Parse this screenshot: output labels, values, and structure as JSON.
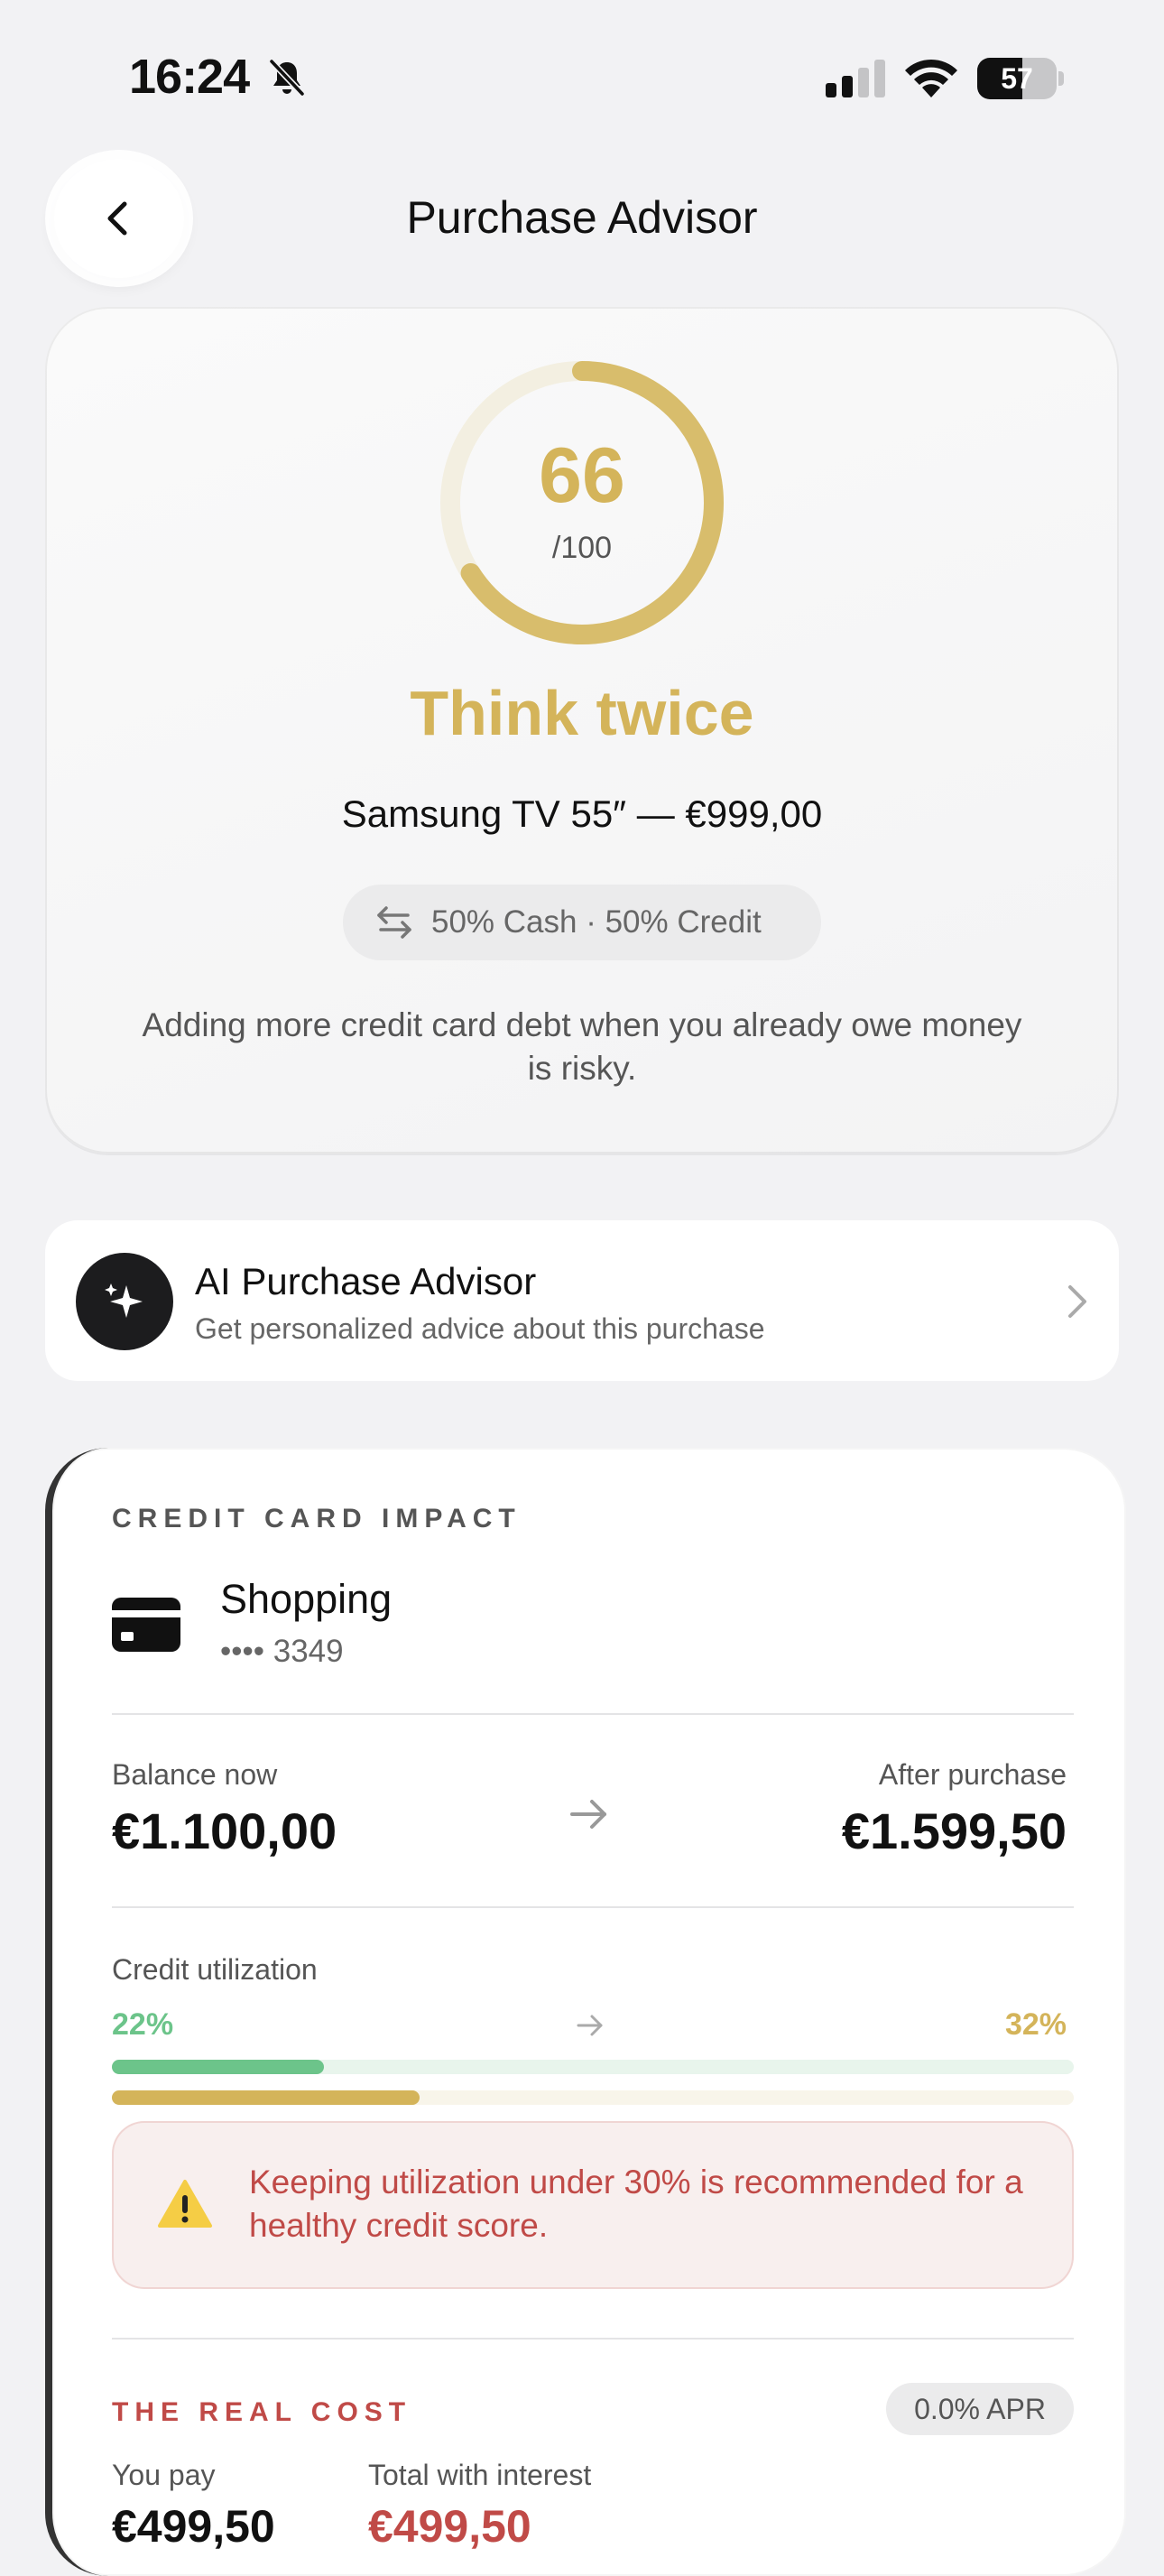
{
  "status_bar": {
    "time": "16:24",
    "battery_level": "57",
    "battery_fraction": 0.57,
    "signal_bars_active": 2,
    "signal_bars_total": 4
  },
  "nav": {
    "back_icon": "chevron-left-icon",
    "title": "Purchase Advisor"
  },
  "score_card": {
    "score": "66",
    "score_max": "/100",
    "score_fraction": 0.66,
    "verdict": "Think twice",
    "product": "Samsung TV 55″ — €999,00",
    "payment_split": "50% Cash · 50% Credit",
    "payment_icon": "swap-arrows-icon",
    "advice": "Adding more credit card debt when you already owe money is risky."
  },
  "ai_advisor": {
    "icon": "sparkles-icon",
    "title": "AI Purchase Advisor",
    "subtitle": "Get personalized advice about this purchase"
  },
  "credit_impact": {
    "section_title": "CREDIT CARD IMPACT",
    "card_icon": "credit-card-icon",
    "card_name": "Shopping",
    "card_number": "•••• 3349",
    "balance_now_label": "Balance now",
    "balance_now": "€1.100,00",
    "after_purchase_label": "After purchase",
    "after_purchase": "€1.599,50",
    "utilization_label": "Credit utilization",
    "utilization_before": "22%",
    "utilization_after": "32%",
    "utilization_before_fraction": 0.22,
    "utilization_after_fraction": 0.32,
    "warning_icon": "warning-triangle-icon",
    "warning_text": "Keeping utilization under 30% is recommended for a healthy credit score.",
    "real_cost_title": "THE REAL COST",
    "apr": "0.0% APR",
    "you_pay_label": "You pay",
    "you_pay": "€499,50",
    "total_label": "Total with interest",
    "total": "€499,50"
  },
  "colors": {
    "accent_gold": "#d4b45a",
    "green": "#6cc48a",
    "red": "#c04a47",
    "background": "#f2f2f4"
  }
}
